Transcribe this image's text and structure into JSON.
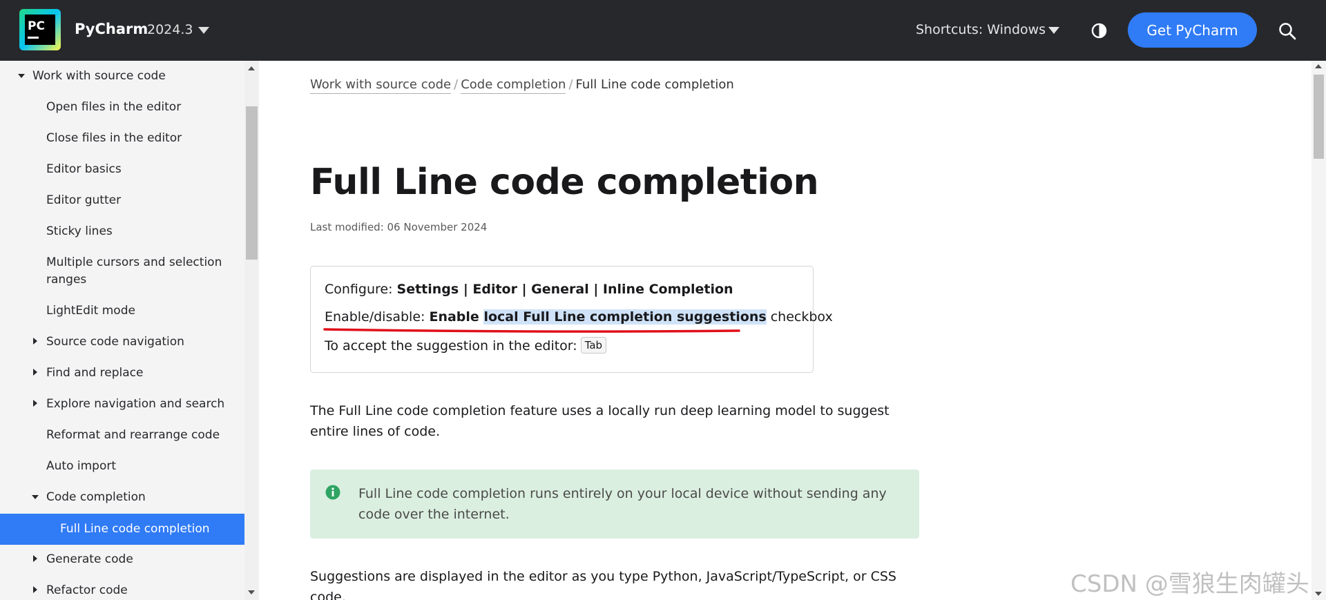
{
  "header": {
    "logo_text": "PC",
    "brand": "PyCharm",
    "version": "2024.3",
    "shortcuts": "Shortcuts: Windows",
    "cta": "Get PyCharm",
    "accent_color": "#307bf6",
    "icons": [
      "chevron-down-icon",
      "contrast-icon",
      "search-icon"
    ]
  },
  "sidebar": {
    "items": [
      {
        "label": "Work with source code",
        "icon": "expanded-triangle-icon"
      },
      {
        "label": "Open files in the editor"
      },
      {
        "label": "Close files in the editor"
      },
      {
        "label": "Editor basics"
      },
      {
        "label": "Editor gutter"
      },
      {
        "label": "Sticky lines"
      },
      {
        "label": "Multiple cursors and selection",
        "label2": "ranges"
      },
      {
        "label": "LightEdit mode"
      },
      {
        "label": "Source code navigation",
        "icon": "collapsed-triangle-icon"
      },
      {
        "label": "Find and replace",
        "icon": "collapsed-triangle-icon"
      },
      {
        "label": "Explore navigation and search",
        "icon": "collapsed-triangle-icon"
      },
      {
        "label": "Reformat and rearrange code"
      },
      {
        "label": "Auto import"
      },
      {
        "label": "Code completion",
        "icon": "expanded-triangle-icon"
      },
      {
        "label": "Full Line code completion",
        "active": true
      },
      {
        "label": "Generate code",
        "icon": "collapsed-triangle-icon"
      },
      {
        "label": "Refactor code",
        "icon": "collapsed-triangle-icon"
      }
    ]
  },
  "breadcrumb": {
    "items": [
      "Work with source code",
      "Code completion",
      "Full Line code completion"
    ],
    "separator": "/"
  },
  "main": {
    "title": "Full Line code completion",
    "last_modified": "Last modified: 06 November 2024",
    "config": {
      "configure_prefix": "Configure: ",
      "configure_path": "Settings | Editor | General | Inline Completion",
      "enable_prefix": "Enable/disable: ",
      "enable_bold_a": "Enable ",
      "enable_bold_highlight": "local Full Line completion suggestions",
      "enable_suffix": " checkbox",
      "accept_prefix": "To accept the suggestion in the editor:",
      "accept_key": "Tab"
    },
    "intro_line1": "The Full Line code completion feature uses a locally run deep learning model to suggest",
    "intro_line2": "entire lines of code.",
    "note": {
      "icon": "info-icon",
      "line1": "Full Line code completion runs entirely on your local device without sending any",
      "line2": "code over the internet.",
      "bg_color": "#dbefe0"
    },
    "para2_line1": "Suggestions are displayed in the editor as you type Python, JavaScript/TypeScript, or CSS",
    "para2_line2": "code."
  },
  "watermark": "CSDN @雪狼生肉罐头"
}
